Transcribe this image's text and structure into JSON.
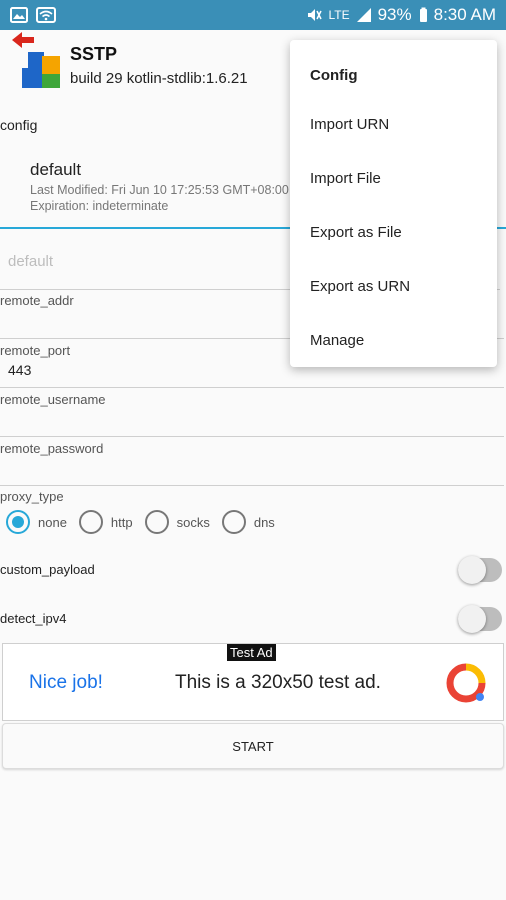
{
  "status_bar": {
    "battery_percent": "93%",
    "time": "8:30 AM",
    "network": "LTE",
    "icons": [
      "image-icon",
      "wifi-icon",
      "mute-icon",
      "signal-icon",
      "battery-icon"
    ]
  },
  "app": {
    "title": "SSTP",
    "subtitle": "build 29 kotlin-stdlib:1.6.21",
    "logo": "puzzle-logo"
  },
  "config_section": {
    "label": "config",
    "item_name": "default",
    "last_modified": "Last Modified: Fri Jun 10 17:25:53 GMT+08:00",
    "expiration": "Expiration: indeterminate"
  },
  "spinner": {
    "value": "default"
  },
  "fields": {
    "remote_addr": {
      "label": "remote_addr",
      "value": ""
    },
    "remote_port": {
      "label": "remote_port",
      "value": "443"
    },
    "remote_username": {
      "label": "remote_username",
      "value": ""
    },
    "remote_password": {
      "label": "remote_password",
      "value": ""
    }
  },
  "proxy": {
    "label": "proxy_type",
    "options": [
      "none",
      "http",
      "socks",
      "dns"
    ],
    "selected": "none"
  },
  "toggles": {
    "custom_payload": {
      "label": "custom_payload",
      "on": false
    },
    "detect_ipv4": {
      "label": "detect_ipv4",
      "on": false
    }
  },
  "ad": {
    "tag": "Test Ad",
    "nice": "Nice job!",
    "text": "This is a 320x50 test ad."
  },
  "start_button": "START",
  "menu": {
    "header": "Config",
    "items": [
      "Import URN",
      "Import File",
      "Export as File",
      "Export as URN",
      "Manage"
    ]
  },
  "colors": {
    "status_bar": "#3a8fb7",
    "accent": "#27a8d8",
    "ad_link": "#1a73e8"
  }
}
